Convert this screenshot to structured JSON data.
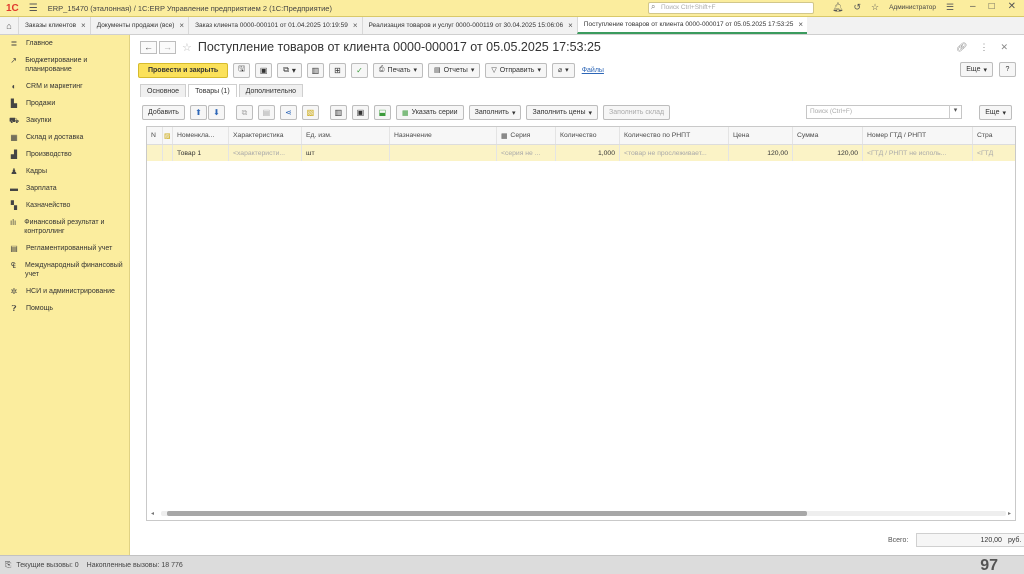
{
  "topbar": {
    "logo": "1С",
    "app_title": "ERP_15470 (эталонная) / 1С:ERP Управление предприятием 2  (1С:Предприятие)",
    "search_placeholder": "Поиск Ctrl+Shift+F",
    "user": "Администратор"
  },
  "tabs": [
    {
      "label": "Заказы клиентов"
    },
    {
      "label": "Документы продажи (все)"
    },
    {
      "label": "Заказ клиента 0000-000101 от 01.04.2025 10:19:59"
    },
    {
      "label": "Реализация товаров и услуг 0000-000119 от 30.04.2025 15:06:06"
    },
    {
      "label": "Поступление товаров от клиента 0000-000017 от 05.05.2025 17:53:25"
    }
  ],
  "sidebar": {
    "items": [
      {
        "label": "Главное",
        "icon": "list-icon"
      },
      {
        "label": "Бюджетирование и планирование",
        "icon": "chart-icon"
      },
      {
        "label": "CRM и маркетинг",
        "icon": "crm-icon"
      },
      {
        "label": "Продажи",
        "icon": "bag-icon"
      },
      {
        "label": "Закупки",
        "icon": "cart-icon"
      },
      {
        "label": "Склад и доставка",
        "icon": "warehouse-icon"
      },
      {
        "label": "Производство",
        "icon": "factory-icon"
      },
      {
        "label": "Кадры",
        "icon": "person-icon"
      },
      {
        "label": "Зарплата",
        "icon": "salary-icon"
      },
      {
        "label": "Казначейство",
        "icon": "treasury-icon"
      },
      {
        "label": "Финансовый результат и контроллинг",
        "icon": "finance-icon"
      },
      {
        "label": "Регламентированный учет",
        "icon": "book-icon"
      },
      {
        "label": "Международный финансовый учет",
        "icon": "intl-icon"
      },
      {
        "label": "НСИ и администрирование",
        "icon": "gear-icon"
      },
      {
        "label": "Помощь",
        "icon": "help-icon"
      }
    ]
  },
  "document": {
    "title": "Поступление товаров от клиента 0000-000017 от 05.05.2025 17:53:25"
  },
  "toolbar": {
    "post_and_close": "Провести и закрыть",
    "print": "Печать",
    "reports": "Отчеты",
    "send": "Отправить",
    "files": "Файлы",
    "more": "Еще",
    "help": "?"
  },
  "form_tabs": [
    "Основное",
    "Товары (1)",
    "Дополнительно"
  ],
  "table_toolbar": {
    "add": "Добавить",
    "specify_series": "Указать серии",
    "fill": "Заполнить",
    "fill_prices": "Заполнить цены",
    "fill_warehouse": "Заполнить склад",
    "search_placeholder": "Поиск (Ctrl+F)",
    "more": "Еще"
  },
  "table": {
    "columns": [
      "N",
      "Номенкла...",
      "Характеристика",
      "Ед. изм.",
      "Назначение",
      "Серия",
      "Количество",
      "Количество по РНПТ",
      "Цена",
      "Сумма",
      "Номер ГТД / РНПТ",
      "Стра"
    ],
    "rows": [
      {
        "n": "",
        "nomenclature": "Товар 1",
        "characteristic": "<характеристи...",
        "unit": "шт",
        "purpose": "",
        "series": "<серия не ...",
        "quantity": "1,000",
        "quantity_rnpt": "<товар не прослеживает...",
        "price": "120,00",
        "sum": "120,00",
        "gtd": "<ГТД / РНПТ не исполь...",
        "country": "<ГТД"
      }
    ]
  },
  "totals": {
    "label": "Всего:",
    "value": "120,00",
    "currency": "руб."
  },
  "statusbar": {
    "current_calls": "Текущие вызовы: 0",
    "accumulated_calls": "Накопленные вызовы: 18 776"
  },
  "slide_number": "97"
}
